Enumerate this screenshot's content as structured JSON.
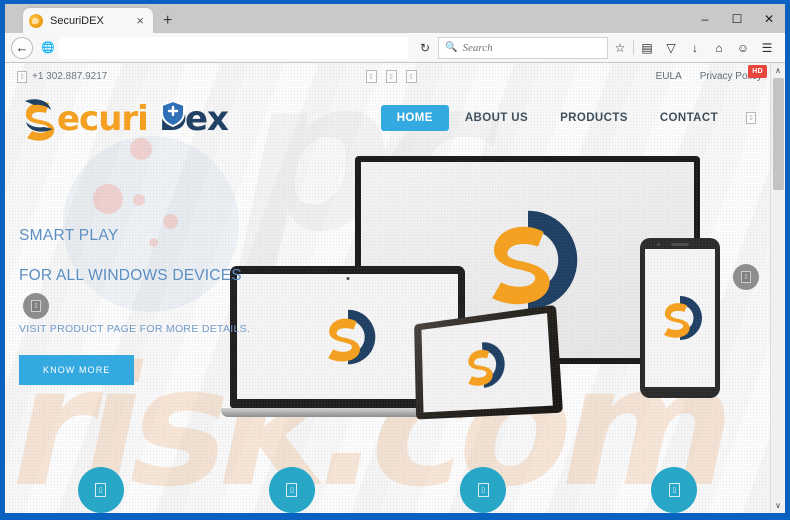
{
  "browser": {
    "tab": {
      "title": "SecuriDEX",
      "favicon": "securidex-favicon",
      "close_label": "×"
    },
    "new_tab_label": "+",
    "window_controls": {
      "minimize": "–",
      "maximize": "☐",
      "close": "✕"
    },
    "toolbar": {
      "back_label": "←",
      "site_identity_icon": "globe-icon",
      "reload_label": "↻",
      "url_value": "",
      "search_placeholder": "Search",
      "search_value": "",
      "search_icon": "search-icon",
      "icons": [
        {
          "name": "bookmark-star-icon",
          "glyph": "☆"
        },
        {
          "name": "reader-view-icon",
          "glyph": "▤"
        },
        {
          "name": "pocket-icon",
          "glyph": "▽"
        },
        {
          "name": "downloads-icon",
          "glyph": "↓"
        },
        {
          "name": "home-icon",
          "glyph": "⌂"
        },
        {
          "name": "smiley-feedback-icon",
          "glyph": "☺"
        },
        {
          "name": "hamburger-menu-icon",
          "glyph": "☰"
        }
      ]
    },
    "scrollbar": {
      "up_arrow": "∧",
      "down_arrow": "∨"
    },
    "video_badge": "HD"
  },
  "site": {
    "topbar": {
      "phone_icon": "broken-image-icon",
      "phone": "+1 302.887.9217",
      "social_icons": [
        {
          "name": "social-facebook-icon",
          "glyph": "❐"
        },
        {
          "name": "social-twitter-icon",
          "glyph": "❐"
        },
        {
          "name": "social-googleplus-icon",
          "glyph": "❐"
        }
      ],
      "links": [
        {
          "name": "eula-link",
          "label": "EULA"
        },
        {
          "name": "privacy-policy-link",
          "label": "Privacy Policy"
        }
      ]
    },
    "header": {
      "logo_text": "SecuriDex",
      "logo_mark": "s-swoosh-shield-logo",
      "nav": [
        {
          "name": "nav-home",
          "label": "HOME",
          "active": true
        },
        {
          "name": "nav-about-us",
          "label": "ABOUT US",
          "active": false
        },
        {
          "name": "nav-products",
          "label": "PRODUCTS",
          "active": false
        },
        {
          "name": "nav-contact",
          "label": "CONTACT",
          "active": false
        }
      ],
      "nav_extra_icon": "broken-image-icon"
    },
    "hero": {
      "title": "SMART PLAY",
      "subtitle": "FOR ALL WINDOWS DEVICES",
      "badge_icon": "broken-image-icon",
      "description": "VISIT PRODUCT PAGE FOR MORE DETAILS.",
      "cta_label": "KNOW MORE",
      "devices": [
        {
          "name": "desktop-monitor-mockup",
          "logo": "securidex-s-logo"
        },
        {
          "name": "laptop-mockup",
          "logo": "securidex-s-logo"
        },
        {
          "name": "tablet-mockup",
          "logo": "securidex-s-logo"
        },
        {
          "name": "smartphone-mockup",
          "logo": "securidex-s-logo"
        }
      ],
      "side_icon": "broken-image-icon"
    },
    "features": [
      {
        "name": "feature-circle-1",
        "icon": "broken-image-icon"
      },
      {
        "name": "feature-circle-2",
        "icon": "broken-image-icon"
      },
      {
        "name": "feature-circle-3",
        "icon": "broken-image-icon"
      },
      {
        "name": "feature-circle-4",
        "icon": "broken-image-icon"
      }
    ],
    "watermark": {
      "top": "pc",
      "bottom": "risk.com"
    }
  },
  "colors": {
    "window_frame": "#0a62c0",
    "brand_blue": "#32aae1",
    "logo_orange": "#f5a01e",
    "logo_navy": "#1f3f63",
    "feature_teal": "#26a7c8",
    "hero_text": "#5b8fc4",
    "badge_red": "#e8463c"
  }
}
